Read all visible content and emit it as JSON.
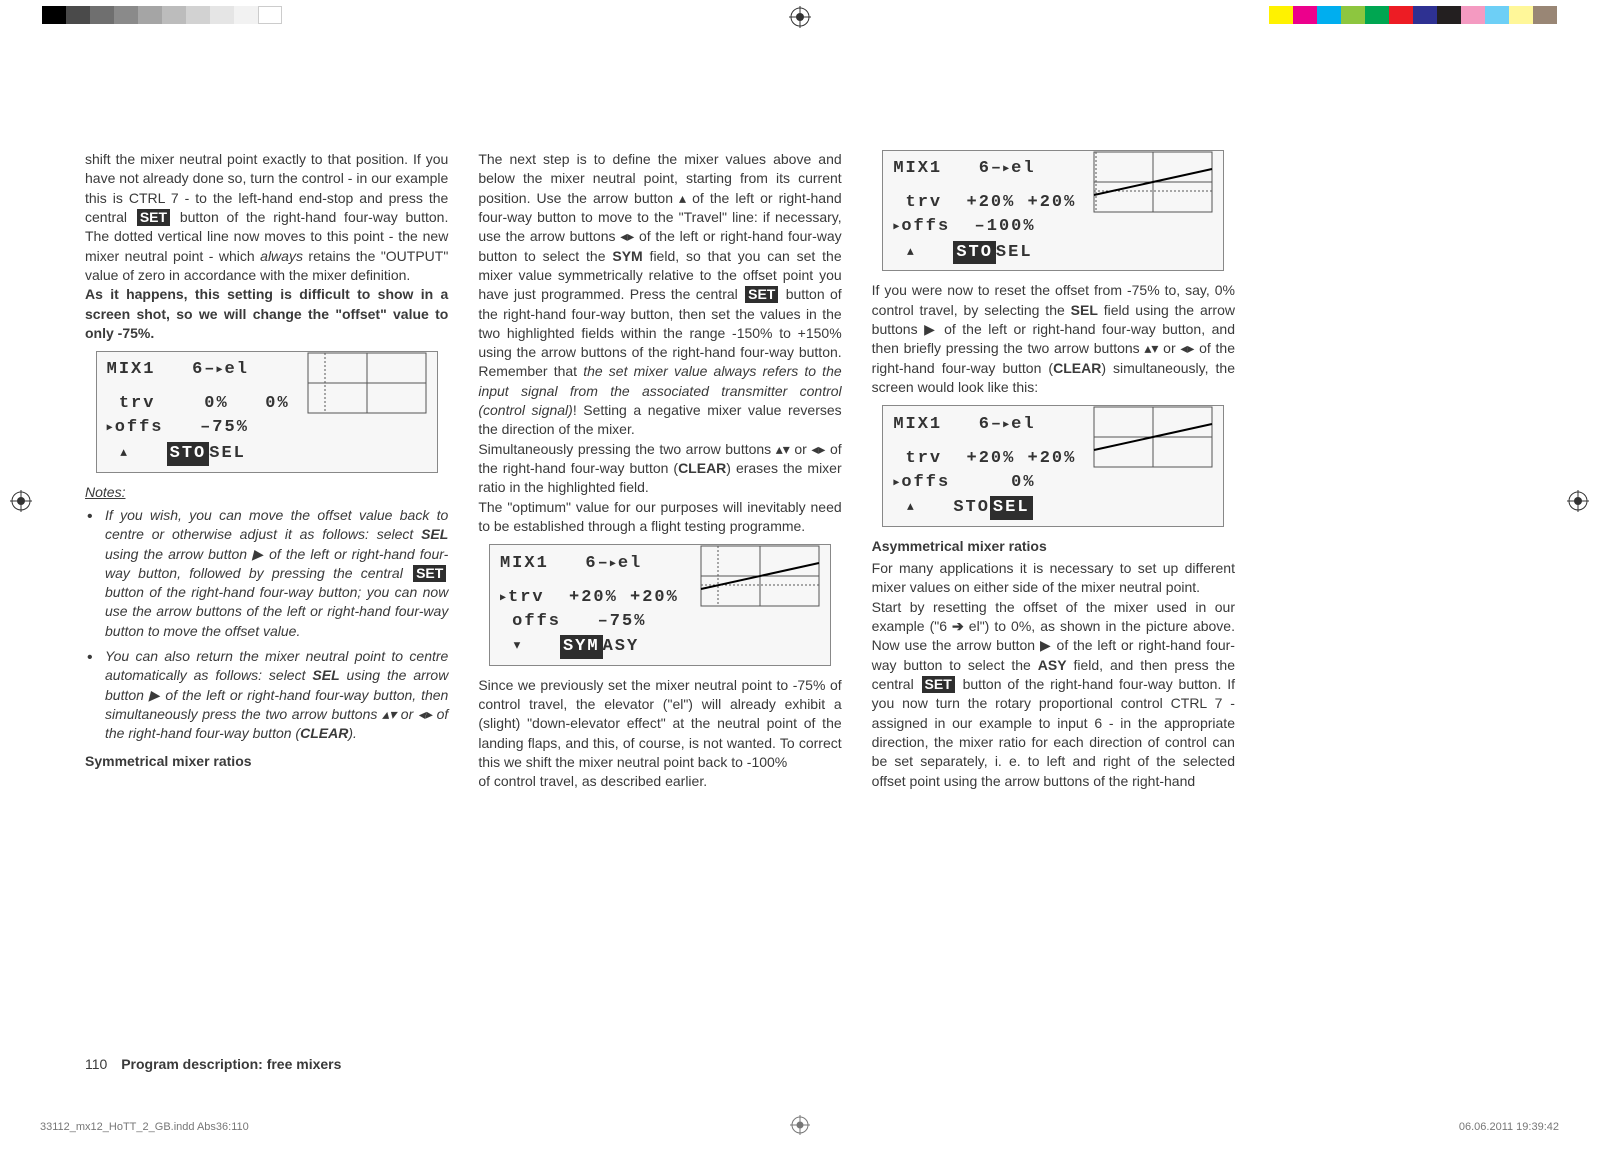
{
  "para1": "shift the mixer neutral point exactly to that position. If you have not already done so, turn the control - in our example this is CTRL 7 - to the left-hand end-stop and press the central ",
  "set": "SET",
  "para1b": " button of the right-hand four-way button. The dotted vertical line now moves to this point - the new mixer neutral point - which ",
  "always": "always",
  "para1c": " retains the \"OUTPUT\" value of zero in accordance with the mixer definition.",
  "bold1": "As it happens, this setting is difficult to show in a screen shot, so we will change the \"offset\" value to only -75%.",
  "lcd1": {
    "title": "MIX1   6–",
    "titleSuffix": "el",
    "row1a": " trv    0%   0%",
    "row2a": "offs   –75%",
    "footerArrow": "▴",
    "sto": "STO",
    "sel": " SEL"
  },
  "notesLabel": "Notes:",
  "note1a": "If you wish, you can move the offset value back to centre or otherwise adjust it as follows: select ",
  "note1sel": "SEL",
  "note1b": " using the arrow button ▶ of the left or right-hand four-way button, followed by pressing the central ",
  "note1c": " button of the right-hand four-way button; you can now use the arrow buttons of the left or right-hand four-way button to move the offset value.",
  "note2a": "You can also return the mixer neutral point to centre automatically as follows: select ",
  "note2sel": "SEL",
  "note2b": " using the arrow button ▶ of the left or right-hand four-way button, then simultaneously press the two arrow buttons ▴▾ or ◂▸ of the right-hand four-way button (",
  "note2clear": "CLEAR",
  "note2c": ").",
  "head2": "Symmetrical mixer ratios",
  "p2a": "The next step is to define the mixer values above and below the mixer neutral point, starting from its current position. Use the arrow button ▴ of the left or right-hand four-way button to move to the \"Travel\" line: if necessary, use the arrow buttons ◂▸ of the left or right-hand four-way button to select the ",
  "p2sym": "SYM",
  "p2b": " field, so that you can set the mixer value symmetrically relative to the offset point you have just programmed. Press the central ",
  "p2c": " button of the right-hand four-way button, then set the values in the two highlighted fields within the range -150% to +150% using the arrow buttons of the right-hand four-way button. Remember that ",
  "p2ital": "the set mixer value always refers to the input signal from the associated transmitter control (control signal)",
  "p2d": "! Setting a negative mixer value reverses the direction of the mixer.",
  "p3a": "Simultaneously pressing the two arrow buttons ▴▾ or ◂▸ of the right-hand four-way button (",
  "p3clear": "CLEAR",
  "p3b": ") erases the mixer ratio in the highlighted field.",
  "p4": "The \"optimum\" value for our purposes will inevitably need to be established through a flight testing programme.",
  "lcd2": {
    "title": "MIX1   6–",
    "row1": "trv  +20% +20%",
    "row2": " offs   –75%",
    "footerArrow": "▾",
    "sym": "SYM",
    "asy": " ASY"
  },
  "p5": "Since we previously set the mixer neutral point to -75% of control travel, the elevator (\"el\") will already exhibit a (slight) \"down-elevator effect\" at the neutral point of the landing flaps, and this, of course, is not wanted. To correct this we shift the mixer neutral point back to -100%",
  "p6": "of control travel, as described earlier.",
  "lcd3": {
    "row1": " trv  +20% +20%",
    "row2": "offs  –100%",
    "sto": "STO",
    "sel": " SEL"
  },
  "p7a": "If you were now to reset the offset from -75% to, say, 0% control travel, by selecting the ",
  "p7sel": "SEL",
  "p7b": " field using the arrow buttons ▶ of the left or right-hand four-way button, and then briefly pressing the two arrow buttons ▴▾ or ◂▸ of the right-hand four-way button (",
  "p7clear": "CLEAR",
  "p7c": ") simultaneously, the screen would look like this:",
  "lcd4": {
    "row1": " trv  +20% +20%",
    "row2": "offs     0%",
    "sto": " STO ",
    "sel": "SEL"
  },
  "head3": "Asymmetrical mixer ratios",
  "p8": "For many applications it is necessary to set up different mixer values on either side of the mixer neutral point.",
  "p9a": "Start by resetting the offset of the mixer used in our example (\"6 ",
  "p9b": " el\") to 0%, as shown in the picture above. Now use the arrow button ▶ of the left or right-hand four-way button to select the ",
  "p9asy": "ASY",
  "p9c": " field, and then press the central ",
  "p9d": " button of the right-hand four-way button. If you now turn the rotary proportional control CTRL 7 - assigned in our example to input 6 - in the appropriate direction, the mixer ratio for each direction of control can be set separately, i. e. to left and right of the selected offset point using the arrow buttons of the right-hand",
  "footerPage": "110",
  "footerTitle": "Program description: free mixers",
  "printLeft": "33112_mx12_HoTT_2_GB.indd   Abs36:110",
  "printRight": "06.06.2011   19:39:42"
}
